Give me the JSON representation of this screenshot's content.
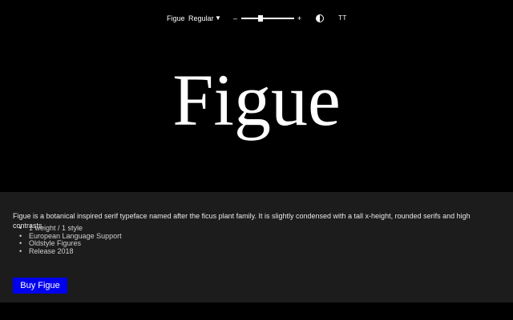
{
  "toolbar": {
    "font_name": "Figue",
    "style_select": {
      "selected": "Regular",
      "icon": "caret-down-icon"
    },
    "size_slider": {
      "minus_label": "–",
      "plus_label": "+",
      "value_fraction": 0.35
    },
    "contrast_toggle": {
      "icon": "contrast-icon"
    },
    "case_toggle_label": "TT"
  },
  "specimen": {
    "text": "Figue"
  },
  "info": {
    "description": "Figue is a botanical inspired serif typeface named after the ficus plant family. It is slightly condensed with a tall x-height, rounded serifs and high contrasts.",
    "features": [
      "1 weight / 1 style",
      "European Language Support",
      "Oldstyle Figures",
      "Release 2018"
    ],
    "buy_label": "Buy Figue"
  },
  "colors": {
    "background": "#000000",
    "panel": "#1c1c1c",
    "accent": "#0000ee",
    "text": "#ffffff"
  }
}
